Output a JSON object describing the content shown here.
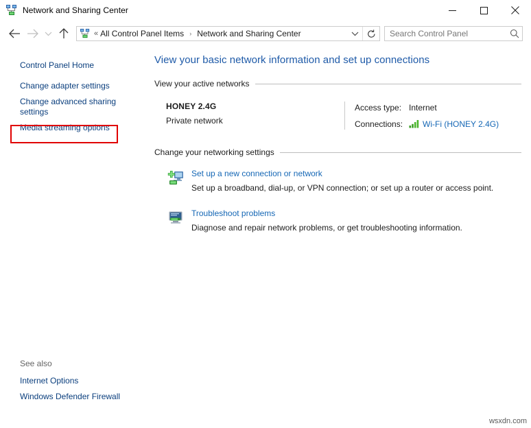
{
  "window": {
    "title": "Network and Sharing Center",
    "icon": "network-sharing-icon",
    "minimize_label": "─",
    "maximize_label": "□",
    "close_label": "✕"
  },
  "nav": {
    "back_label": "←",
    "forward_label": "→",
    "recent_label": "⌄",
    "up_label": "↑",
    "breadcrumb_icon": "network-sharing-icon",
    "breadcrumb_overflow": "«",
    "breadcrumb": [
      {
        "label": "All Control Panel Items"
      },
      {
        "label": "Network and Sharing Center"
      }
    ],
    "breadcrumb_separator": "›",
    "dropdown_label": "⌄",
    "refresh_label": "↻"
  },
  "search": {
    "placeholder": "Search Control Panel",
    "value": "",
    "icon": "search-icon"
  },
  "sidebar": {
    "items": [
      {
        "label": "Control Panel Home",
        "highlighted": false
      },
      {
        "label": "Change adapter settings",
        "highlighted": true
      },
      {
        "label": "Change advanced sharing settings",
        "highlighted": false
      },
      {
        "label": "Media streaming options",
        "highlighted": false
      }
    ],
    "see_also_label": "See also",
    "see_also_items": [
      {
        "label": "Internet Options"
      },
      {
        "label": "Windows Defender Firewall"
      }
    ]
  },
  "main": {
    "page_title": "View your basic network information and set up connections",
    "active_networks_heading": "View your active networks",
    "active_network": {
      "name": "HONEY 2.4G",
      "type": "Private network",
      "access_type_label": "Access type:",
      "access_type_value": "Internet",
      "connections_label": "Connections:",
      "connections_icon": "wifi-signal-icon",
      "connections_value": "Wi-Fi (HONEY 2.4G)"
    },
    "change_settings_heading": "Change your networking settings",
    "tasks": [
      {
        "icon": "new-connection-icon",
        "link": "Set up a new connection or network",
        "description": "Set up a broadband, dial-up, or VPN connection; or set up a router or access point."
      },
      {
        "icon": "troubleshoot-icon",
        "link": "Troubleshoot problems",
        "description": "Diagnose and repair network problems, or get troubleshooting information."
      }
    ]
  },
  "watermark": {
    "text": "wsxdn.com"
  },
  "colors": {
    "title_blue": "#1e5aa8",
    "link_blue": "#1567b5",
    "sidebar_link": "#0a3e7d",
    "highlight_red": "#e00000",
    "signal_green": "#3a9e23"
  }
}
